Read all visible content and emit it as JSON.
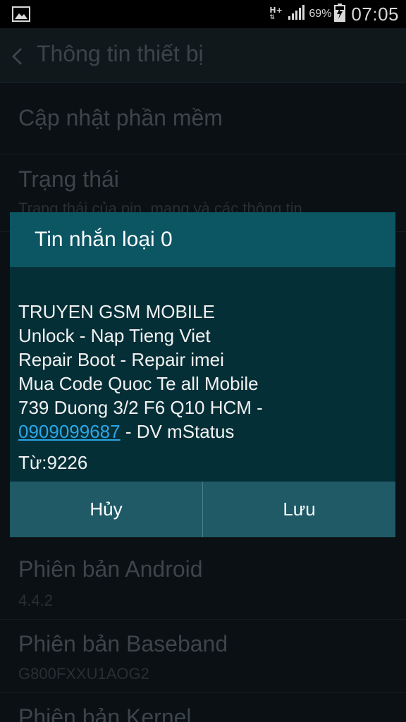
{
  "status_bar": {
    "network_type": "H+",
    "battery_percent": "69%",
    "time": "07:05",
    "icons": [
      "image-icon",
      "data-arrows-icon",
      "signal-icon",
      "battery-charging-icon"
    ]
  },
  "action_bar": {
    "title": "Thông tin thiết bị",
    "back_icon": "chevron-left-icon"
  },
  "settings_list": [
    {
      "title": "Cập nhật phần mềm",
      "subtitle": ""
    },
    {
      "title": "Trạng thái",
      "subtitle": "Trạng thái của pin, mạng và các thông tin"
    },
    {
      "title": "Phiên bản Android",
      "subtitle": "4.4.2"
    },
    {
      "title": "Phiên bản Baseband",
      "subtitle": "G800FXXU1AOG2"
    },
    {
      "title": "Phiên bản Kernel",
      "subtitle": ""
    }
  ],
  "dialog": {
    "title": "Tin nhắn loại 0",
    "message_lines": [
      "TRUYEN GSM MOBILE",
      "Unlock - Nap Tieng Viet",
      "Repair Boot - Repair imei",
      "Mua Code Quoc Te all Mobile",
      "739 Duong 3/2 F6 Q10 HCM -"
    ],
    "phone_link": "0909099687",
    "last_line_suffix": " - DV mStatus",
    "from": "Từ:9226",
    "cancel_label": "Hủy",
    "save_label": "Lưu"
  },
  "colors": {
    "dialog_header": "#0c5563",
    "dialog_body": "#052f37",
    "dialog_buttons": "#1f5a66",
    "link": "#2aa6e6"
  }
}
